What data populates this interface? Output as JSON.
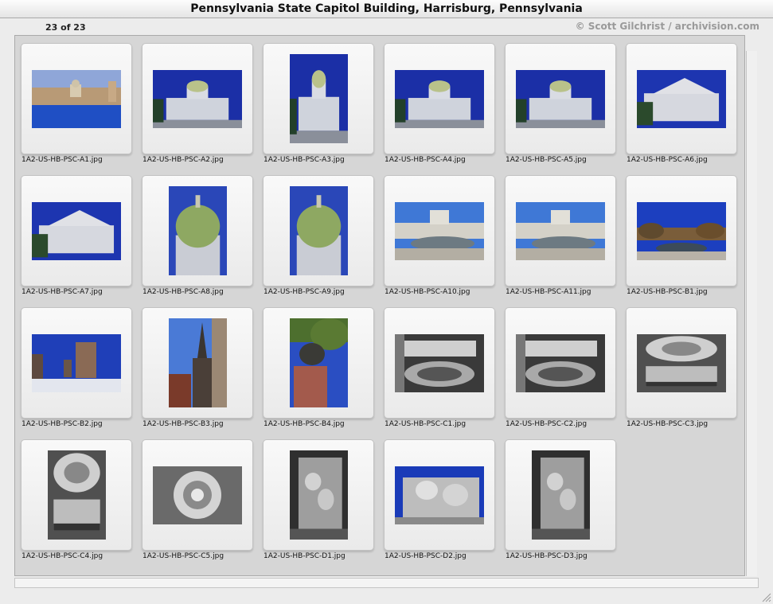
{
  "window": {
    "title": "Pennsylvania State Capitol Building, Harrisburg, Pennsylvania"
  },
  "header": {
    "count": "23 of 23",
    "credit": "© Scott Gilchrist / archivision.com"
  },
  "thumbnails": [
    {
      "file": "1A2-US-HB-PSC-A1.jpg",
      "orientation": "land",
      "style": "river"
    },
    {
      "file": "1A2-US-HB-PSC-A2.jpg",
      "orientation": "land",
      "style": "dome"
    },
    {
      "file": "1A2-US-HB-PSC-A3.jpg",
      "orientation": "port",
      "style": "dome"
    },
    {
      "file": "1A2-US-HB-PSC-A4.jpg",
      "orientation": "land",
      "style": "dome"
    },
    {
      "file": "1A2-US-HB-PSC-A5.jpg",
      "orientation": "land",
      "style": "dome"
    },
    {
      "file": "1A2-US-HB-PSC-A6.jpg",
      "orientation": "land",
      "style": "wing"
    },
    {
      "file": "1A2-US-HB-PSC-A7.jpg",
      "orientation": "land",
      "style": "wing"
    },
    {
      "file": "1A2-US-HB-PSC-A8.jpg",
      "orientation": "port",
      "style": "dome-green"
    },
    {
      "file": "1A2-US-HB-PSC-A9.jpg",
      "orientation": "port",
      "style": "dome-green"
    },
    {
      "file": "1A2-US-HB-PSC-A10.jpg",
      "orientation": "land",
      "style": "plaza"
    },
    {
      "file": "1A2-US-HB-PSC-A11.jpg",
      "orientation": "land",
      "style": "plaza"
    },
    {
      "file": "1A2-US-HB-PSC-B1.jpg",
      "orientation": "land",
      "style": "plaza-trees"
    },
    {
      "file": "1A2-US-HB-PSC-B2.jpg",
      "orientation": "land",
      "style": "street"
    },
    {
      "file": "1A2-US-HB-PSC-B3.jpg",
      "orientation": "port",
      "style": "spire"
    },
    {
      "file": "1A2-US-HB-PSC-B4.jpg",
      "orientation": "port",
      "style": "statue"
    },
    {
      "file": "1A2-US-HB-PSC-C1.jpg",
      "orientation": "land",
      "style": "interior"
    },
    {
      "file": "1A2-US-HB-PSC-C2.jpg",
      "orientation": "land",
      "style": "interior"
    },
    {
      "file": "1A2-US-HB-PSC-C3.jpg",
      "orientation": "land",
      "style": "rotunda"
    },
    {
      "file": "1A2-US-HB-PSC-C4.jpg",
      "orientation": "port",
      "style": "rotunda"
    },
    {
      "file": "1A2-US-HB-PSC-C5.jpg",
      "orientation": "land",
      "style": "ceiling"
    },
    {
      "file": "1A2-US-HB-PSC-D1.jpg",
      "orientation": "port",
      "style": "sculpture"
    },
    {
      "file": "1A2-US-HB-PSC-D2.jpg",
      "orientation": "land",
      "style": "sculpture-sky"
    },
    {
      "file": "1A2-US-HB-PSC-D3.jpg",
      "orientation": "port",
      "style": "sculpture"
    }
  ]
}
